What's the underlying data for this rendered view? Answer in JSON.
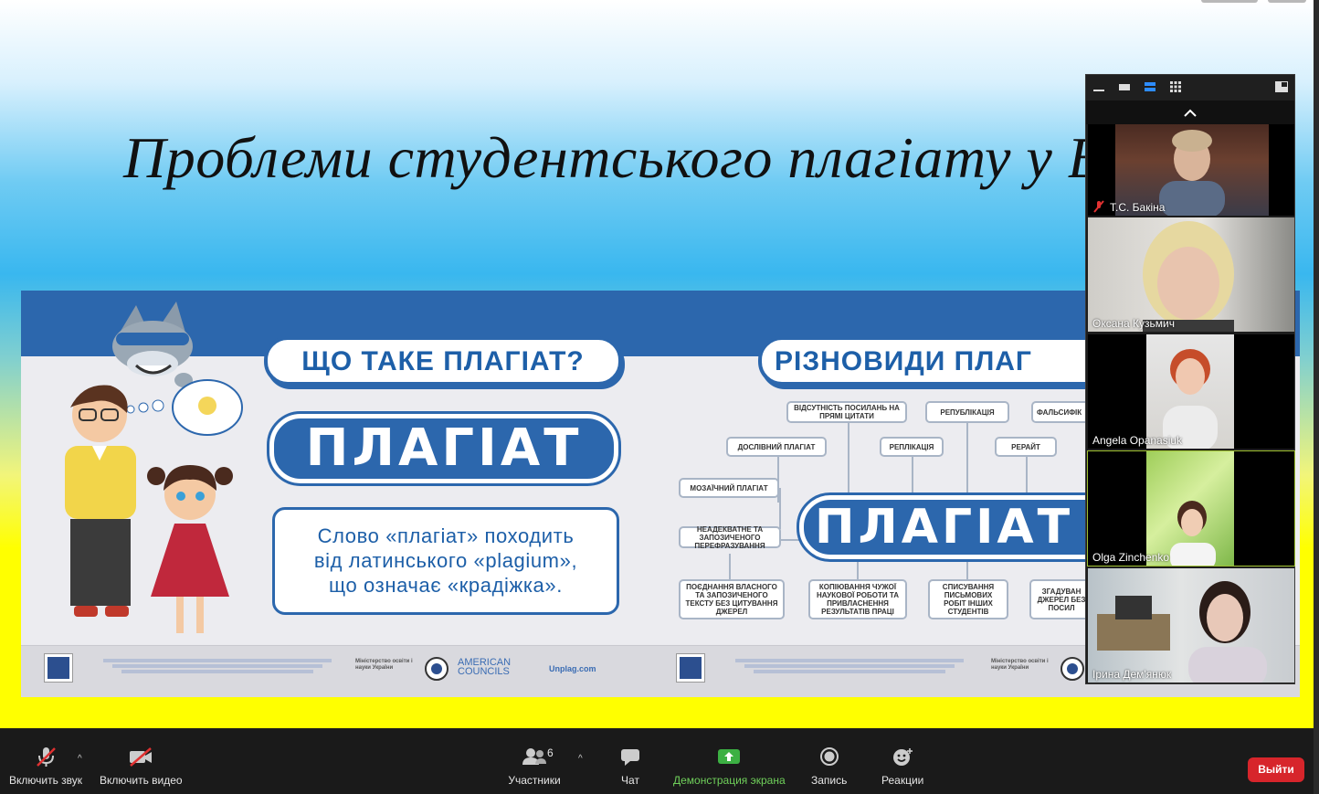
{
  "slide": {
    "title": "Проблеми студентського плагіату у В",
    "banner": {
      "left_heading": "ЩО ТАКЕ ПЛАГІАТ?",
      "left_word": "ПЛАГІАТ",
      "definition_lines": [
        "Слово «плагіат» походить",
        "від латинського «plagium»,",
        "що означає «крадіжка»."
      ],
      "right_heading": "РІЗНОВИДИ ПЛАГ",
      "right_word": "ПЛАГІАТ",
      "nodes": {
        "no_refs": "ВІДСУТНІСТЬ ПОСИЛАНЬ НА ПРЯМІ ЦИТАТИ",
        "republication": "РЕПУБЛІКАЦІЯ",
        "falsification": "ФАЛЬСИФІК",
        "verbatim": "ДОСЛІВНИЙ ПЛАГІАТ",
        "replication": "РЕПЛІКАЦІЯ",
        "repost": "РЕРАЙТ",
        "mosaic": "МОЗАЇЧНИЙ ПЛАГІАТ",
        "paraphrase": "НЕАДЕКВАТНЕ ТА ЗАПОЗИЧЕНОГО ПЕРЕФРАЗУВАННЯ",
        "combination": "ПОЄДНАННЯ ВЛАСНОГО ТА ЗАПОЗИЧЕНОГО ТЕКСТУ БЕЗ ЦИТУВАННЯ ДЖЕРЕЛ",
        "copying": "КОПІЮВАННЯ ЧУЖОЇ НАУКОВОЇ РОБОТИ ТА ПРИВЛАСНЕННЯ РЕЗУЛЬТАТІВ ПРАЦІ",
        "cheating": "СПИСУВАННЯ ПИСЬМОВИХ РОБІТ ІНШИХ СТУДЕНТІВ",
        "mention": "ЗГАДУВАН ДЖЕРЕЛ БЕЗ ПОСИЛ"
      },
      "footer": {
        "ministry": "Міністерство освіти і науки України",
        "american_councils": "AMERICAN COUNCILS",
        "unplag": "Unplag.com"
      }
    }
  },
  "participants_panel": {
    "tiles": [
      {
        "name": "Т.С. Бакіна",
        "muted": true
      },
      {
        "name": "Оксана Кузьмич",
        "muted": false
      },
      {
        "name": "Angela Opanasiuk",
        "muted": false
      },
      {
        "name": "Olga Zinchenko",
        "muted": false,
        "active": true
      },
      {
        "name": "Ірина Дем'янюк",
        "muted": false
      }
    ]
  },
  "toolbar": {
    "audio_label": "Включить звук",
    "video_label": "Включить видео",
    "participants_label": "Участники",
    "participants_count": "6",
    "chat_label": "Чат",
    "share_label": "Демонстрация экрана",
    "record_label": "Запись",
    "reactions_label": "Реакции",
    "leave_label": "Выйти"
  },
  "colors": {
    "accent_blue": "#2c67ad",
    "share_green": "#6fcf5a",
    "leave_red": "#d7252b",
    "toolbar_bg": "#1a1a1a"
  }
}
